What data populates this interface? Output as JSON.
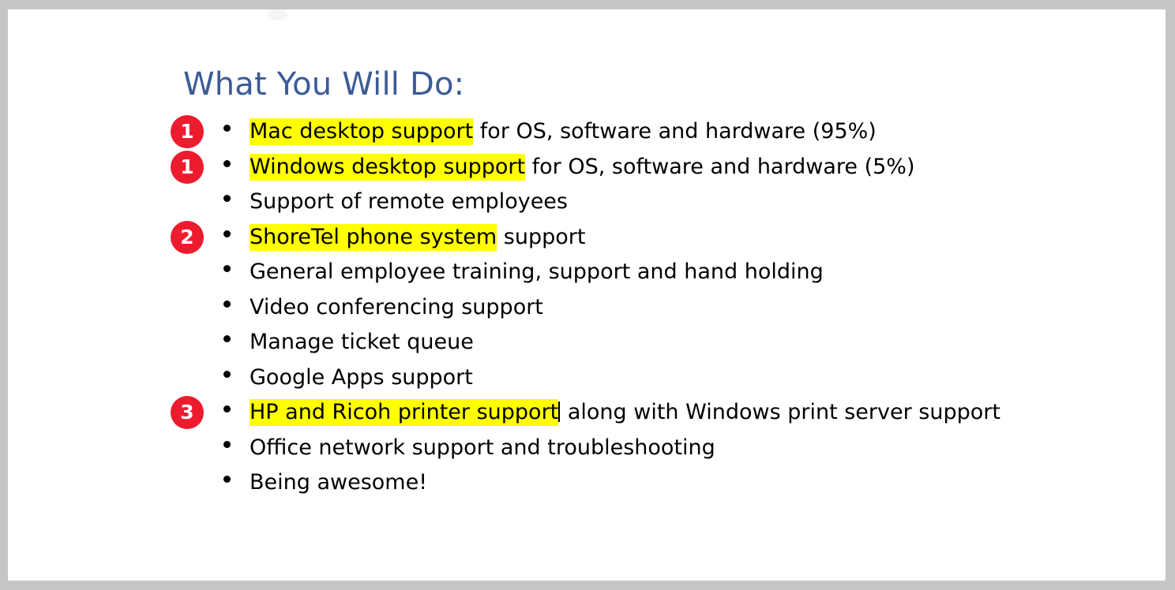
{
  "slide": {
    "title": "What You Will Do:",
    "title_color": "#3c5b96",
    "background": "#ffffff",
    "frame_color": "#c6c6c6",
    "highlight_color": "#ffff00",
    "badge_color": "#ed1b2e",
    "badge_text_color": "#ffffff",
    "bullet_color": "#000000"
  },
  "bullets": [
    {
      "highlight": "Mac desktop support",
      "rest": " for OS, software and hardware (95%)",
      "caret": false,
      "badge": "1"
    },
    {
      "highlight": "Windows desktop support",
      "rest": " for OS, software and hardware (5%)",
      "caret": false,
      "badge": "1"
    },
    {
      "highlight": "",
      "rest": "Support of remote employees",
      "caret": false,
      "badge": ""
    },
    {
      "highlight": "ShoreTel phone system",
      "rest": " support",
      "caret": false,
      "badge": "2"
    },
    {
      "highlight": "",
      "rest": "General employee training, support and hand holding",
      "caret": false,
      "badge": ""
    },
    {
      "highlight": "",
      "rest": "Video conferencing support",
      "caret": false,
      "badge": ""
    },
    {
      "highlight": "",
      "rest": "Manage ticket queue",
      "caret": false,
      "badge": ""
    },
    {
      "highlight": "",
      "rest": "Google Apps support",
      "caret": false,
      "badge": ""
    },
    {
      "highlight": "HP and Ricoh printer support",
      "rest": " along with Windows print server support",
      "caret": true,
      "badge": "3"
    },
    {
      "highlight": "",
      "rest": "Office network support and troubleshooting",
      "caret": false,
      "badge": ""
    },
    {
      "highlight": "",
      "rest": "Being awesome!",
      "caret": false,
      "badge": ""
    }
  ]
}
